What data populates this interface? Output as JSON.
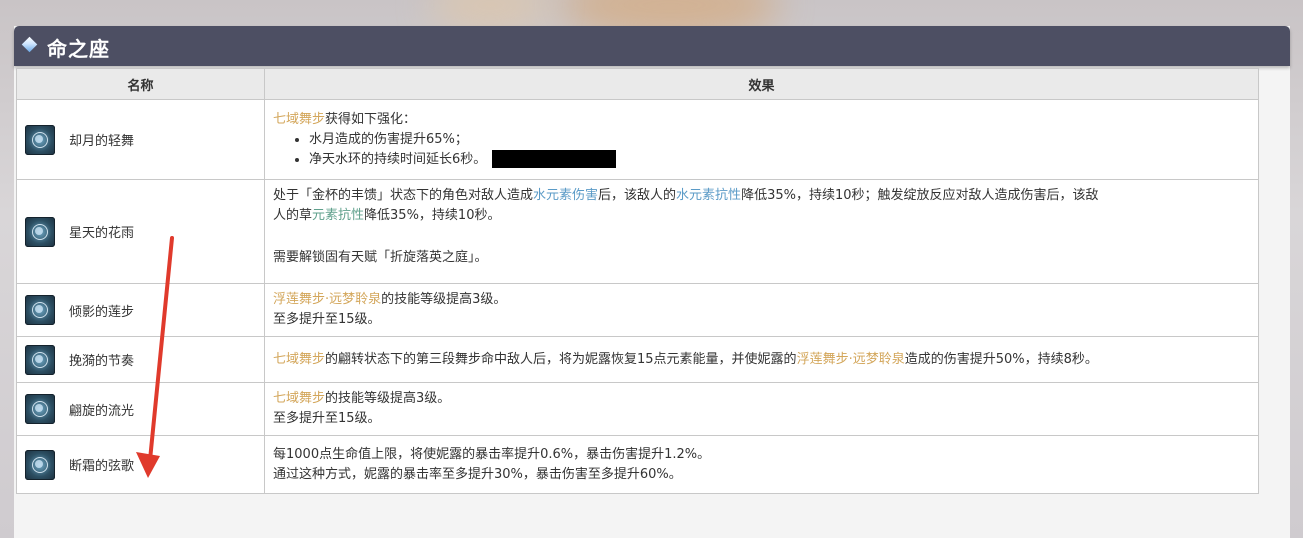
{
  "section": {
    "title": "命之座"
  },
  "table": {
    "headers": {
      "name": "名称",
      "effect": "效果"
    },
    "rows": [
      {
        "name": "却月的轻舞",
        "icon": "constellation-icon",
        "intro_highlight": "七域舞步",
        "intro_rest": "获得如下强化：",
        "bullets": [
          "水月造成的伤害提升65%；",
          "净天水环的持续时间延长6秒。"
        ]
      },
      {
        "name": "星天的花雨",
        "icon": "constellation-icon",
        "line1_a": "处于「金杯的丰馈」状态下的角色对敌人造成",
        "line1_hl1": "水元素伤害",
        "line1_b": "后，该敌人的",
        "line1_hl2": "水元素抗性",
        "line1_c": "降低35%，持续10秒；触发绽放反应对敌人造成伤害后，该敌",
        "line2_a": "人的草",
        "line2_hl": "元素抗性",
        "line2_b": "降低35%，持续10秒。",
        "note": "需要解锁固有天赋「折旋落英之庭」。"
      },
      {
        "name": "倾影的莲步",
        "icon": "constellation-icon",
        "highlight": "浮莲舞步·远梦聆泉",
        "rest": "的技能等级提高3级。",
        "line2": "至多提升至15级。"
      },
      {
        "name": "挽漪的节奏",
        "icon": "constellation-icon",
        "hl1": "七域舞步",
        "mid": "的翩转状态下的第三段舞步命中敌人后，将为妮露恢复15点元素能量，并使妮露的",
        "hl2": "浮莲舞步·远梦聆泉",
        "end": "造成的伤害提升50%，持续8秒。"
      },
      {
        "name": "翩旋的流光",
        "icon": "constellation-icon",
        "highlight": "七域舞步",
        "rest": "的技能等级提高3级。",
        "line2": "至多提升至15级。"
      },
      {
        "name": "断霜的弦歌",
        "icon": "constellation-icon",
        "line1": "每1000点生命值上限，将使妮露的暴击率提升0.6%，暴击伤害提升1.2%。",
        "line2": "通过这种方式，妮露的暴击率至多提升30%，暴击伤害至多提升60%。"
      }
    ]
  },
  "colors": {
    "header_bg": "#4d4f63",
    "highlight_gold": "#d3a65a",
    "highlight_blue": "#5b9bc7",
    "annotation_red": "#e03a2c"
  }
}
